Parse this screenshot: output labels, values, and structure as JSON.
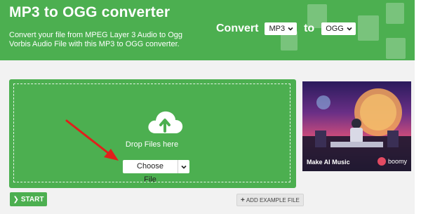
{
  "header": {
    "title": "MP3 to OGG converter",
    "description": "Convert your file from MPEG Layer 3 Audio to Ogg Vorbis Audio File with this MP3 to OGG converter.",
    "convert_label": "Convert",
    "from_format": "MP3",
    "to_label": "to",
    "to_format": "OGG"
  },
  "upload": {
    "drop_text": "Drop Files here",
    "choose_label": "Choose File"
  },
  "actions": {
    "start_label": "START",
    "example_label": "ADD EXAMPLE FILE"
  },
  "ad": {
    "caption": "Make AI Music",
    "brand": "boomy"
  },
  "colors": {
    "accent": "#4caf50",
    "annotation_arrow": "#e0201b"
  }
}
